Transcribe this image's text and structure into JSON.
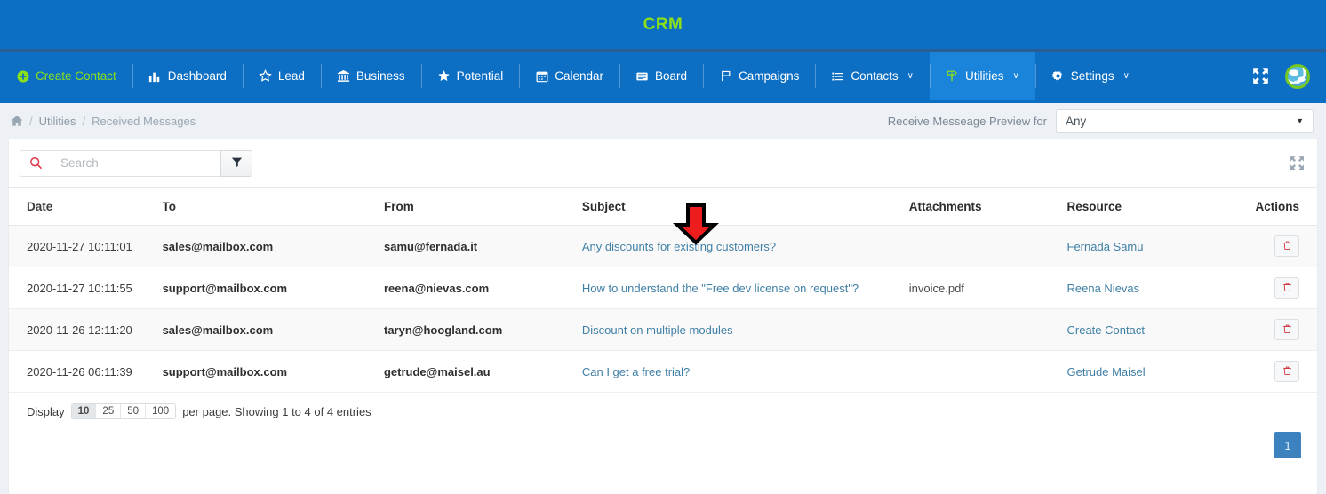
{
  "header": {
    "brand_title": "CRM",
    "nav_items": [
      {
        "label": "Create Contact",
        "icon": "plus-circle-icon",
        "style": "green",
        "caret": false
      },
      {
        "label": "Dashboard",
        "icon": "chart-bar-icon",
        "style": "plain",
        "caret": false
      },
      {
        "label": "Lead",
        "icon": "star-outline-icon",
        "style": "plain",
        "caret": false
      },
      {
        "label": "Business",
        "icon": "bank-icon",
        "style": "plain",
        "caret": false
      },
      {
        "label": "Potential",
        "icon": "star-filled-icon",
        "style": "plain",
        "caret": false
      },
      {
        "label": "Calendar",
        "icon": "calendar-icon",
        "style": "plain",
        "caret": false
      },
      {
        "label": "Board",
        "icon": "board-icon",
        "style": "plain",
        "caret": false
      },
      {
        "label": "Campaigns",
        "icon": "flag-icon",
        "style": "plain",
        "caret": false
      },
      {
        "label": "Contacts",
        "icon": "list-ul-icon",
        "style": "plain",
        "caret": true
      },
      {
        "label": "Utilities",
        "icon": "map-signs-icon",
        "style": "active",
        "caret": true
      },
      {
        "label": "Settings",
        "icon": "gear-icon",
        "style": "plain",
        "caret": true
      }
    ],
    "caret_glyph": "∨",
    "expand_icon": "expand-arrows-icon",
    "avatar_icon": "globe-avatar-icon"
  },
  "breadcrumb": {
    "home_icon": "home-icon",
    "separator": "/",
    "items": [
      "Utilities",
      "Received Messages"
    ],
    "preview_label": "Receive Messeage Preview for",
    "select_value": "Any",
    "select_caret": "▼"
  },
  "toolbar": {
    "search_icon": "search-icon",
    "search_value": "",
    "search_placeholder": "Search",
    "filter_icon": "filter-icon",
    "expand_icon": "expand-arrows-icon"
  },
  "table": {
    "columns": [
      "Date",
      "To",
      "From",
      "Subject",
      "Attachments",
      "Resource",
      "Actions"
    ],
    "rows": [
      {
        "date": "2020-11-27 10:11:01",
        "to": "sales@mailbox.com",
        "from": "samu@fernada.it",
        "subject": "Any discounts for existing customers?",
        "attachment": "",
        "resource": "Fernada Samu",
        "action_icon": "trash-icon"
      },
      {
        "date": "2020-11-27 10:11:55",
        "to": "support@mailbox.com",
        "from": "reena@nievas.com",
        "subject": "How to understand the \"Free dev license on request\"?",
        "attachment": "invoice.pdf",
        "resource": "Reena Nievas",
        "action_icon": "trash-icon"
      },
      {
        "date": "2020-11-26 12:11:20",
        "to": "sales@mailbox.com",
        "from": "taryn@hoogland.com",
        "subject": "Discount on multiple modules",
        "attachment": "",
        "resource": "Create Contact",
        "action_icon": "trash-icon"
      },
      {
        "date": "2020-11-26 06:11:39",
        "to": "support@mailbox.com",
        "from": "getrude@maisel.au",
        "subject": "Can I get a free trial?",
        "attachment": "",
        "resource": "Getrude Maisel",
        "action_icon": "trash-icon"
      }
    ]
  },
  "footer": {
    "display_label": "Display",
    "page_sizes": [
      "10",
      "25",
      "50",
      "100"
    ],
    "selected_page_size": "10",
    "per_page_text": "per page. Showing 1 to 4 of 4 entries",
    "current_page": "1"
  },
  "annotation": {
    "arrow_icon": "down-arrow-annotation",
    "arrow_color": "#ee1c1c",
    "arrow_outline": "#000000"
  },
  "colors": {
    "navbar_blue": "#0d6fc4",
    "nav_active_blue": "#1a83da",
    "brand_green": "#8ce019",
    "link_blue": "#3f7fa5",
    "danger_red": "#d0353f",
    "page_bg": "#edf1f5",
    "pager_blue": "#3c82be"
  }
}
